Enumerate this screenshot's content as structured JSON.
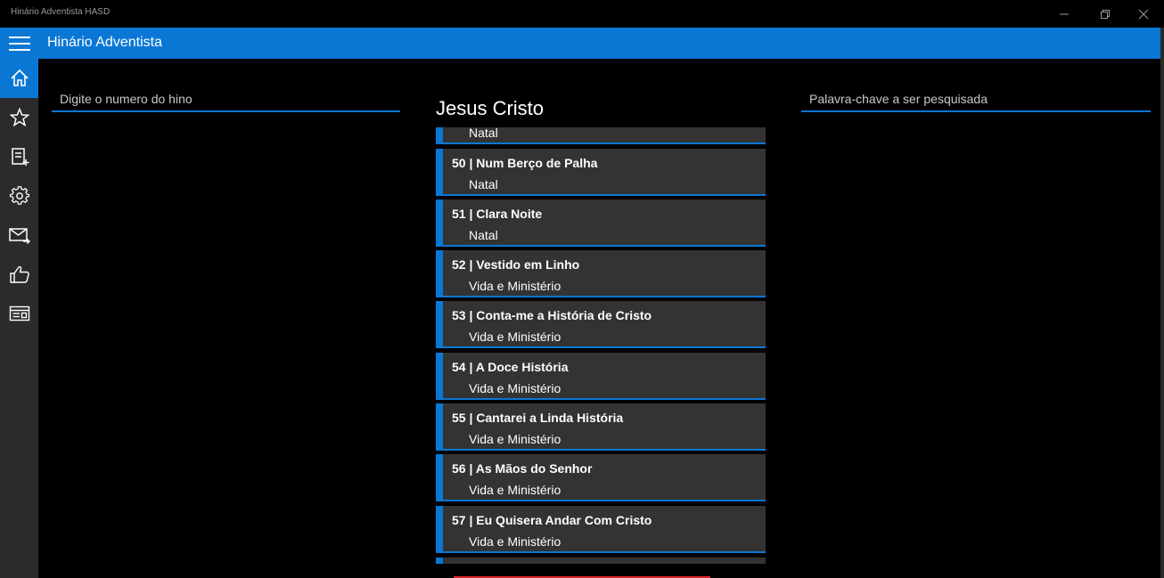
{
  "window": {
    "title": "Hinário Adventista HASD"
  },
  "header": {
    "title": "Hinário Adventista"
  },
  "sidebar": {
    "items": [
      {
        "name": "home",
        "icon": "home-icon",
        "active": true
      },
      {
        "name": "favorites",
        "icon": "star-icon",
        "active": false
      },
      {
        "name": "playlist",
        "icon": "playlist-add-icon",
        "active": false
      },
      {
        "name": "settings",
        "icon": "gear-icon",
        "active": false
      },
      {
        "name": "contact",
        "icon": "mail-forward-icon",
        "active": false
      },
      {
        "name": "rate",
        "icon": "thumbs-up-icon",
        "active": false
      },
      {
        "name": "about",
        "icon": "card-info-icon",
        "active": false
      }
    ]
  },
  "search_number": {
    "placeholder": "Digite o numero do hino"
  },
  "search_keyword": {
    "placeholder": "Palavra-chave a ser pesquisada"
  },
  "section": {
    "title": "Jesus Cristo"
  },
  "hymns": {
    "partial_top_subtitle": "Natal",
    "items": [
      {
        "title": "50 | Num Berço de Palha",
        "category": "Natal"
      },
      {
        "title": "51 | Clara Noite",
        "category": "Natal"
      },
      {
        "title": "52 | Vestido em Linho",
        "category": "Vida e Ministério"
      },
      {
        "title": "53 | Conta-me a História de Cristo",
        "category": "Vida e Ministério"
      },
      {
        "title": "54 | A Doce História",
        "category": "Vida e Ministério"
      },
      {
        "title": "55 | Cantarei a Linda História",
        "category": "Vida e Ministério"
      },
      {
        "title": "56 | As Mãos do Senhor",
        "category": "Vida e Ministério"
      },
      {
        "title": "57 | Eu Quisera Andar Com Cristo",
        "category": "Vida e Ministério"
      }
    ]
  },
  "colors": {
    "accent": "#0a77d5",
    "card": "#333333",
    "sidebar": "#2b2b2b",
    "background": "#000000"
  }
}
